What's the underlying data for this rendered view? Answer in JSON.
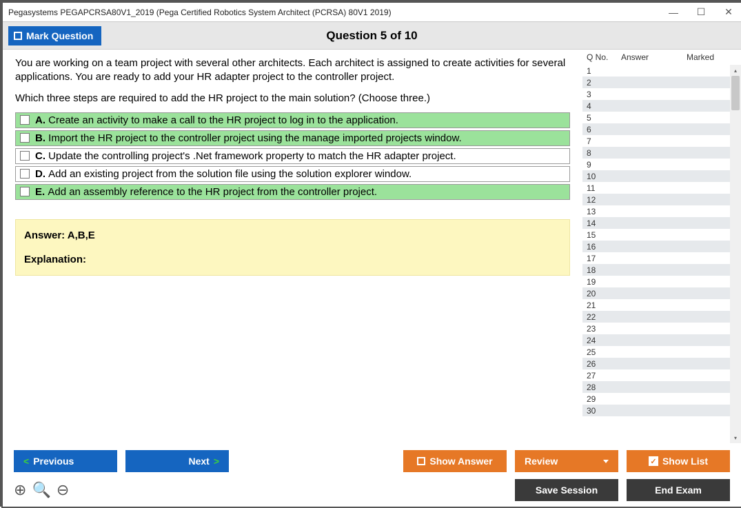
{
  "window": {
    "title": "Pegasystems PEGAPCRSA80V1_2019 (Pega Certified Robotics System Architect (PCRSA) 80V1 2019)"
  },
  "header": {
    "mark_label": "Mark Question",
    "question_title": "Question 5 of 10"
  },
  "question": {
    "p1": "You are working on a team project with several other architects. Each architect is assigned to create activities for several applications. You are ready to add your HR adapter project to the controller project.",
    "p2": "Which three steps are required to add the HR project to the main solution? (Choose three.)"
  },
  "options": [
    {
      "letter": "A.",
      "text": "Create an activity to make a call to the HR project to log in to the application.",
      "correct": true
    },
    {
      "letter": "B.",
      "text": "Import the HR project to the controller project using the manage imported projects window.",
      "correct": true
    },
    {
      "letter": "C.",
      "text": "Update the controlling project's .Net framework property to match the HR adapter project.",
      "correct": false
    },
    {
      "letter": "D.",
      "text": "Add an existing project from the solution file using the solution explorer window.",
      "correct": false
    },
    {
      "letter": "E.",
      "text": "Add an assembly reference to the HR project from the controller project.",
      "correct": true
    }
  ],
  "answer_box": {
    "answer_label": "Answer: A,B,E",
    "explanation_label": "Explanation:"
  },
  "side": {
    "header": {
      "q": "Q No.",
      "a": "Answer",
      "m": "Marked"
    },
    "count": 30
  },
  "buttons": {
    "previous": "Previous",
    "next": "Next",
    "show_answer": "Show Answer",
    "review": "Review",
    "show_list": "Show List",
    "save_session": "Save Session",
    "end_exam": "End Exam"
  }
}
